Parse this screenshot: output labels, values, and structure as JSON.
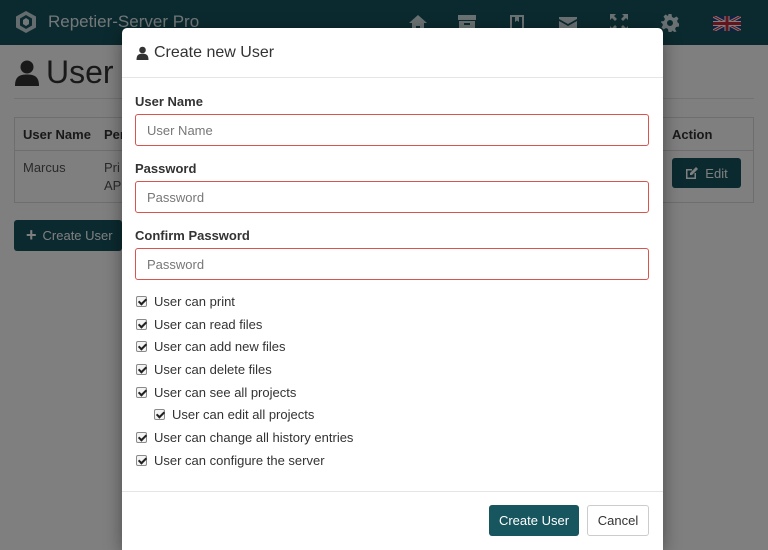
{
  "app": {
    "brand": "Repetier-Server Pro",
    "nav_icons": [
      "home-icon",
      "archive-icon",
      "book-icon",
      "envelope-icon",
      "fullscreen-icon",
      "gear-icon"
    ],
    "language_flag": "uk-flag-icon"
  },
  "page": {
    "title": "User",
    "table": {
      "headers": [
        "User Name",
        "Per",
        "Action"
      ],
      "rows": [
        {
          "user_name": "Marcus",
          "permissions_line1": "Pri",
          "permissions_line2": "AP",
          "action": "Edit"
        }
      ]
    },
    "create_user_button": "Create User"
  },
  "modal": {
    "title": "Create new User",
    "fields": [
      {
        "label": "User Name",
        "placeholder": "User Name",
        "value": ""
      },
      {
        "label": "Password",
        "placeholder": "Password",
        "value": ""
      },
      {
        "label": "Confirm Password",
        "placeholder": "Password",
        "value": ""
      }
    ],
    "permissions": [
      {
        "label": "User can print",
        "checked": true
      },
      {
        "label": "User can read files",
        "checked": true
      },
      {
        "label": "User can add new files",
        "checked": true
      },
      {
        "label": "User can delete files",
        "checked": true
      },
      {
        "label": "User can see all projects",
        "checked": true
      },
      {
        "label": "User can edit all projects",
        "checked": true
      },
      {
        "label": "User can change all history entries",
        "checked": true
      },
      {
        "label": "User can configure the server",
        "checked": true
      }
    ],
    "submit_label": "Create User",
    "cancel_label": "Cancel"
  },
  "colors": {
    "primary": "#17555f",
    "error_border": "#d9534f"
  }
}
